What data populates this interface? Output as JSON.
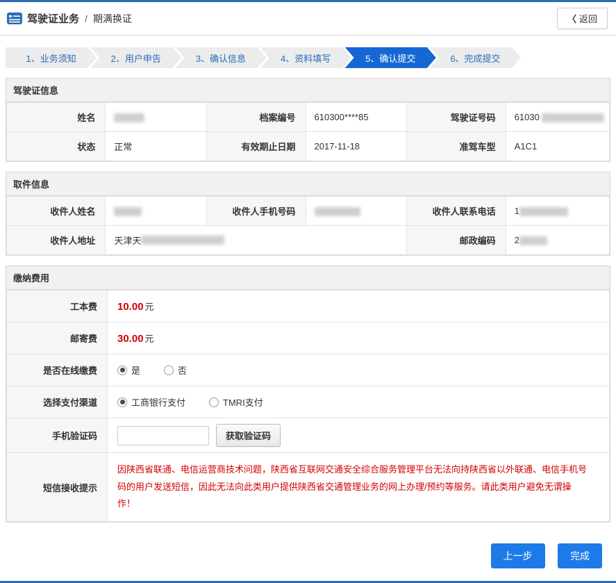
{
  "header": {
    "title_primary": "驾驶证业务",
    "title_separator": "/",
    "title_secondary": "期满换证",
    "back_label": "返回",
    "back_chevron": "〈"
  },
  "steps": [
    {
      "label": "1、业务须知",
      "active": false
    },
    {
      "label": "2、用户申告",
      "active": false
    },
    {
      "label": "3、确认信息",
      "active": false
    },
    {
      "label": "4、资料填写",
      "active": false
    },
    {
      "label": "5、确认提交",
      "active": true
    },
    {
      "label": "6、完成提交",
      "active": false
    }
  ],
  "license_info": {
    "section_title": "驾驶证信息",
    "labels": {
      "name": "姓名",
      "file_no": "档案编号",
      "license_no": "驾驶证号码",
      "status": "状态",
      "valid_until": "有效期止日期",
      "vehicle_type": "准驾车型"
    },
    "values": {
      "name": "",
      "file_no": "610300****85",
      "license_no_prefix": "61030",
      "status": "正常",
      "valid_until": "2017-11-18",
      "vehicle_type": "A1C1"
    }
  },
  "pickup_info": {
    "section_title": "取件信息",
    "labels": {
      "recipient_name": "收件人姓名",
      "recipient_mobile": "收件人手机号码",
      "recipient_phone": "收件人联系电话",
      "recipient_address": "收件人地址",
      "postal_code": "邮政编码"
    },
    "values": {
      "recipient_name": "",
      "recipient_mobile": "",
      "recipient_phone_prefix": "1",
      "recipient_address_prefix": "天津天",
      "postal_code_prefix": "2"
    }
  },
  "payment": {
    "section_title": "缴纳费用",
    "production_fee_label": "工本费",
    "production_fee_value": "10.00",
    "mailing_fee_label": "邮寄费",
    "mailing_fee_value": "30.00",
    "fee_unit": "元",
    "online_payment_label": "是否在线缴费",
    "online_yes_label": "是",
    "online_no_label": "否",
    "online_selected": "是",
    "channel_label": "选择支付渠道",
    "channel_icbc_label": "工商银行支付",
    "channel_tmri_label": "TMRI支付",
    "channel_selected": "工商银行支付",
    "sms_code_label": "手机验证码",
    "sms_code_value": "",
    "get_code_button": "获取验证码",
    "sms_notice_label": "短信接收提示",
    "sms_notice_text": "因陕西省联通、电信运营商技术问题，陕西省互联网交通安全综合服务管理平台无法向持陕西省以外联通、电信手机号码的用户发送短信，因此无法向此类用户提供陕西省交通管理业务的网上办理/预约等服务。请此类用户避免无谓操作！"
  },
  "footer": {
    "prev_button": "上一步",
    "finish_button": "完成"
  },
  "colors": {
    "accent_blue": "#2e6cb5",
    "active_step_blue": "#1568d4",
    "button_blue": "#1d7be8",
    "warning_red": "#d40000"
  }
}
